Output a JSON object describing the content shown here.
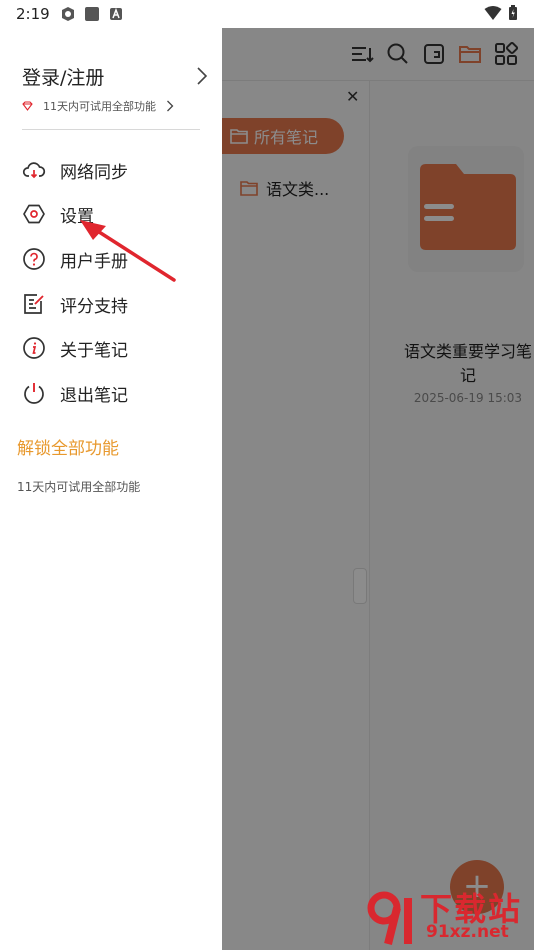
{
  "status_bar": {
    "time": "2:19"
  },
  "drawer": {
    "login_label": "登录/注册",
    "trial_text": "11天内可试用全部功能",
    "menu": [
      {
        "label": "网络同步",
        "icon": "cloud-sync-icon"
      },
      {
        "label": "设置",
        "icon": "settings-hexagon-icon"
      },
      {
        "label": "用户手册",
        "icon": "help-circle-icon"
      },
      {
        "label": "评分支持",
        "icon": "rate-edit-icon"
      },
      {
        "label": "关于笔记",
        "icon": "info-circle-icon"
      },
      {
        "label": "退出笔记",
        "icon": "power-icon"
      }
    ],
    "unlock_label": "解锁全部功能",
    "unlock_trial_text": "11天内可试用全部功能"
  },
  "background_app": {
    "folders_header": "所有笔记",
    "folder_item": "语文类...",
    "note": {
      "title": "语文类重要学习笔记",
      "date": "2025-06-19 15:03"
    },
    "fab_label": "+"
  },
  "watermark": {
    "brand": "下载站",
    "url": "91xz.net"
  },
  "colors": {
    "accent": "#e8784e",
    "unlock": "#e8992e",
    "arrow": "#e0262e"
  }
}
